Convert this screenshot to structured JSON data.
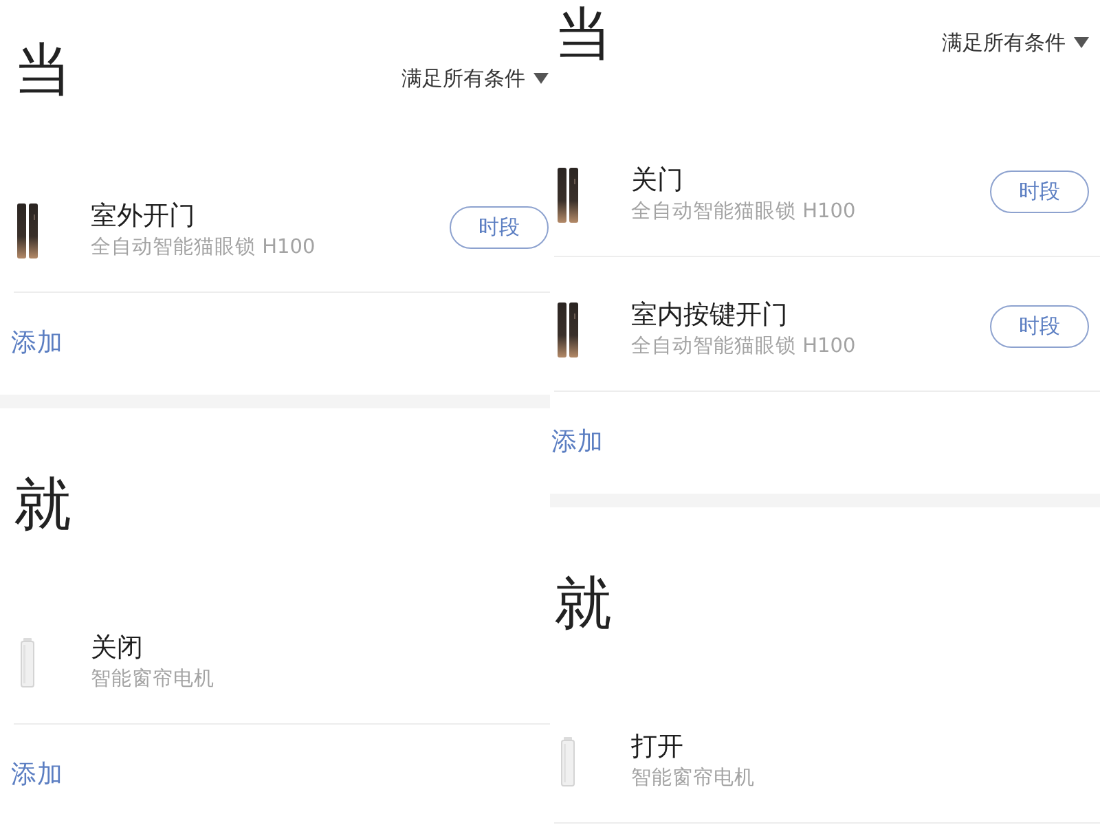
{
  "panels": [
    {
      "conditions": {
        "heading": "当",
        "match_mode": "满足所有条件",
        "items": [
          {
            "title": "室外开门",
            "device": "全自动智能猫眼锁 H100",
            "button": "时段"
          }
        ],
        "add_link": "添加"
      },
      "actions": {
        "heading": "就",
        "items": [
          {
            "title": "关闭",
            "device": "智能窗帘电机"
          }
        ],
        "add_link": "添加"
      }
    },
    {
      "conditions": {
        "heading": "当",
        "match_mode": "满足所有条件",
        "items": [
          {
            "title": "关门",
            "device": "全自动智能猫眼锁 H100",
            "button": "时段"
          },
          {
            "title": "室内按键开门",
            "device": "全自动智能猫眼锁 H100",
            "button": "时段"
          }
        ],
        "add_link": "添加"
      },
      "actions": {
        "heading": "就",
        "items": [
          {
            "title": "打开",
            "device": "智能窗帘电机"
          }
        ]
      }
    }
  ]
}
